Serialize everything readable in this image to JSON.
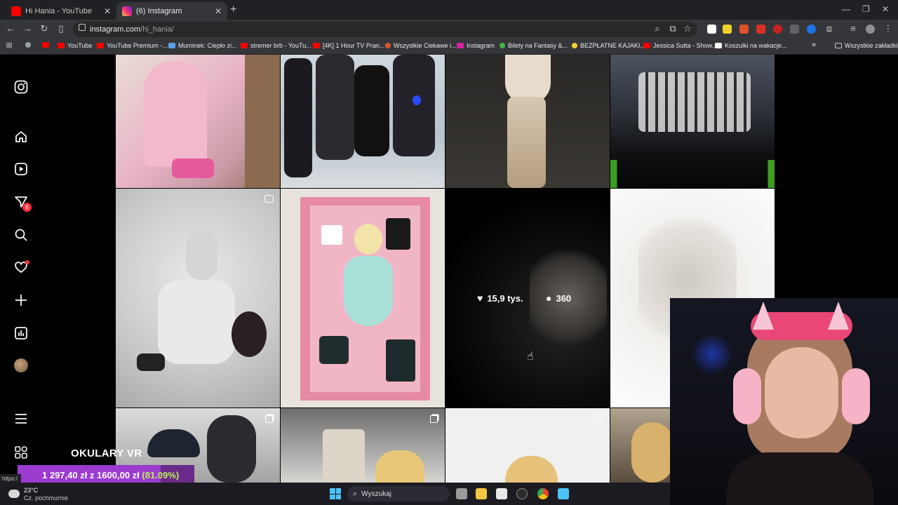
{
  "browser": {
    "tabs": [
      {
        "title": "Hi Hania - YouTube",
        "favicon_color": "#ff0000"
      },
      {
        "title": "(6) Instagram",
        "favicon_color": "#d6249f"
      }
    ],
    "url_host": "instagram.com",
    "url_path": "/hi_hania/",
    "bookmarks": [
      {
        "label": "YouTube",
        "color": "#ff0000"
      },
      {
        "label": "YouTube Premium -...",
        "color": "#ff0000"
      },
      {
        "label": "Muminek: Ciepło zi...",
        "color": "#5aa0e6"
      },
      {
        "label": "stremer brb - YouTu...",
        "color": "#ff0000"
      },
      {
        "label": "[4K] 1 Hour TV Pran...",
        "color": "#ff0000"
      },
      {
        "label": "Wszystkie Ciekawe i...",
        "color": "#e0542a"
      },
      {
        "label": "Instagram",
        "color": "#d6249f"
      },
      {
        "label": "Bilety na Fantasy &...",
        "color": "#3bb54a"
      },
      {
        "label": "BEZPŁATNE KAJAKI...",
        "color": "#f0d12b"
      },
      {
        "label": "Jessica Sutta - Show...",
        "color": "#ff0000"
      },
      {
        "label": "Koszulki na wakacje...",
        "color": "#ffffff"
      }
    ],
    "bookmarks_folder": "Wszystkie zakładki"
  },
  "instagram": {
    "sidebar": {
      "notification_count": "6"
    },
    "hover_post": {
      "likes": "15,9 tys.",
      "comments": "360"
    }
  },
  "stream": {
    "vr_title": "OKULARY VR",
    "goal_text": "1 297,40 zł z 1600,00 zł",
    "goal_percent": "(81.09%)",
    "goal_fraction": 0.8109,
    "status_url": "https:/"
  },
  "taskbar": {
    "temperature": "23°C",
    "weather_desc": "Cz. pochmurnie",
    "search_placeholder": "Wyszukaj"
  }
}
